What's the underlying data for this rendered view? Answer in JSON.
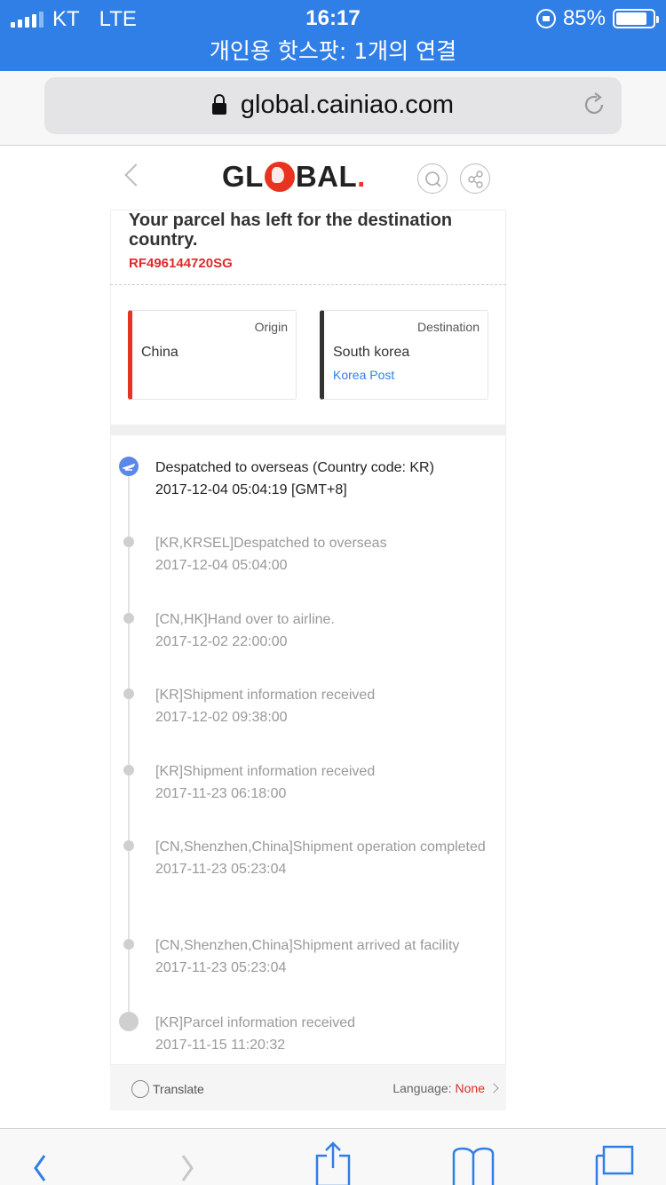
{
  "status_bar": {
    "carrier": "KT",
    "network": "LTE",
    "time": "16:17",
    "battery": "85%",
    "battery_level": 0.85
  },
  "hotspot_banner": "개인용 핫스팟: 1개의 연결",
  "browser": {
    "url": "global.cainiao.com"
  },
  "site": {
    "logo_prefix": "GL",
    "logo_suffix": "BAL",
    "logo_dot": ".",
    "brand_color": "#e8341e"
  },
  "parcel": {
    "status": "Your parcel has left for the destination country.",
    "tracking_number": "RF496144720SG"
  },
  "route": {
    "origin": {
      "label": "Origin",
      "country": "China"
    },
    "destination": {
      "label": "Destination",
      "country": "South korea",
      "carrier": "Korea Post"
    }
  },
  "events": [
    {
      "desc": "Despatched to overseas (Country code: KR)",
      "time": "2017-12-04 05:04:19 [GMT+8]"
    },
    {
      "desc": "[KR,KRSEL]Despatched to overseas",
      "time": "2017-12-04 05:04:00"
    },
    {
      "desc": "[CN,HK]Hand over to airline.",
      "time": "2017-12-02 22:00:00"
    },
    {
      "desc": "[KR]Shipment information received",
      "time": "2017-12-02 09:38:00"
    },
    {
      "desc": "[KR]Shipment information received",
      "time": "2017-11-23 06:18:00"
    },
    {
      "desc": "[CN,Shenzhen,China]Shipment operation completed",
      "time": "2017-11-23 05:23:04"
    },
    {
      "desc": "[CN,Shenzhen,China]Shipment arrived at facility",
      "time": "2017-11-23 05:23:04"
    },
    {
      "desc": "[KR]Parcel information received",
      "time": "2017-11-15 11:20:32"
    }
  ],
  "footer": {
    "translate_label": "Translate",
    "language_label": "Language:",
    "language_value": "None"
  }
}
